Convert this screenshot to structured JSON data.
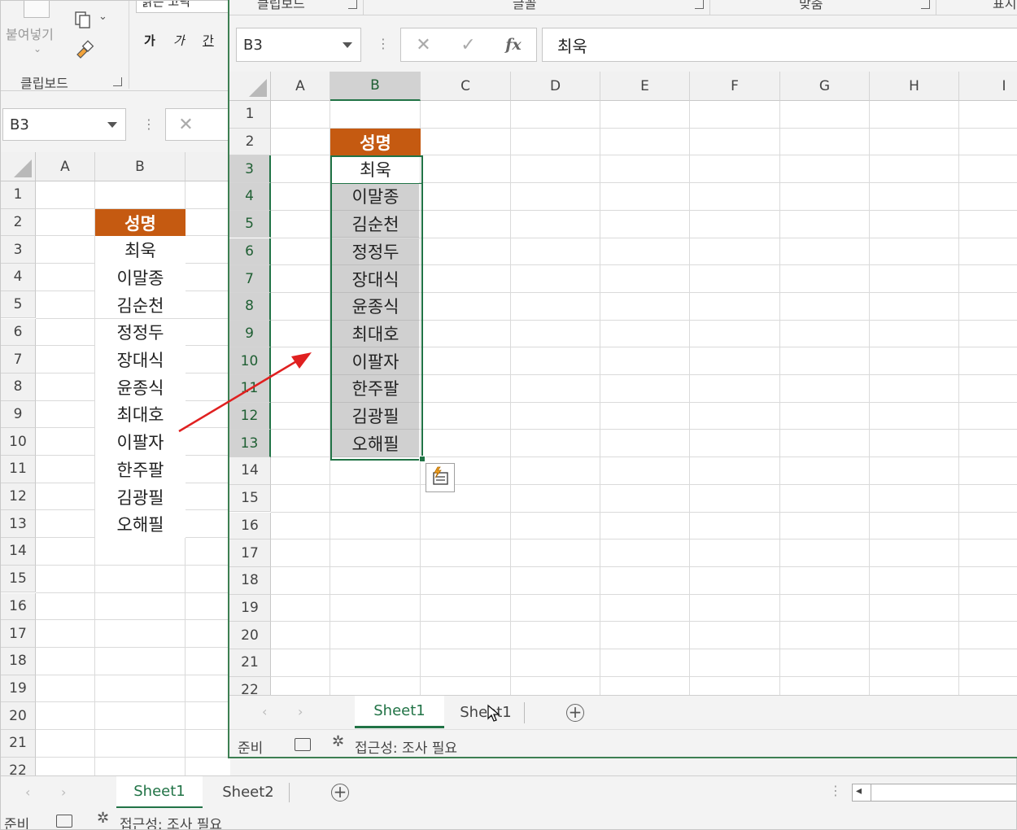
{
  "ribbon": {
    "font_name": "맑은 고딕",
    "paste_label": "붙여넣기",
    "clipboard_group": "클립보드",
    "font_group": "글꼴",
    "align_group": "맞춤",
    "number_group_partial": "표시",
    "bold_glyph": "가",
    "italic_glyph": "가",
    "underline_glyph": "간"
  },
  "front": {
    "namebox": "B3",
    "formula": "최욱",
    "fx": "fx",
    "columns": [
      "A",
      "B",
      "C",
      "D",
      "E",
      "F",
      "G",
      "H",
      "I"
    ],
    "rows": [
      "1",
      "2",
      "3",
      "4",
      "5",
      "6",
      "7",
      "8",
      "9",
      "10",
      "11",
      "12",
      "13",
      "14",
      "15",
      "16",
      "17",
      "18",
      "19",
      "20",
      "21",
      "22"
    ],
    "header_cell": "성명",
    "names": [
      "최욱",
      "이말종",
      "김순천",
      "정정두",
      "장대식",
      "윤종식",
      "최대호",
      "이팔자",
      "한주팔",
      "김광필",
      "오해필"
    ],
    "tabs": [
      "Sheet1",
      "Sheet1"
    ],
    "status_ready": "준비",
    "status_access": "접근성: 조사 필요"
  },
  "back": {
    "namebox": "B3",
    "columns": [
      "A",
      "B"
    ],
    "rows": [
      "1",
      "2",
      "3",
      "4",
      "5",
      "6",
      "7",
      "8",
      "9",
      "10",
      "11",
      "12",
      "13",
      "14",
      "15",
      "16",
      "17",
      "18",
      "19",
      "20",
      "21",
      "22"
    ],
    "header_cell": "성명",
    "names": [
      "최욱",
      "이말종",
      "김순천",
      "정정두",
      "장대식",
      "윤종식",
      "최대호",
      "이팔자",
      "한주팔",
      "김광필",
      "오해필"
    ],
    "tabs": [
      "Sheet1",
      "Sheet2"
    ],
    "status_ready": "준비",
    "status_access": "접근성: 조사 필요"
  },
  "colors": {
    "accent": "#217346",
    "header_fill": "#c55a11",
    "arrow": "#e02020"
  }
}
